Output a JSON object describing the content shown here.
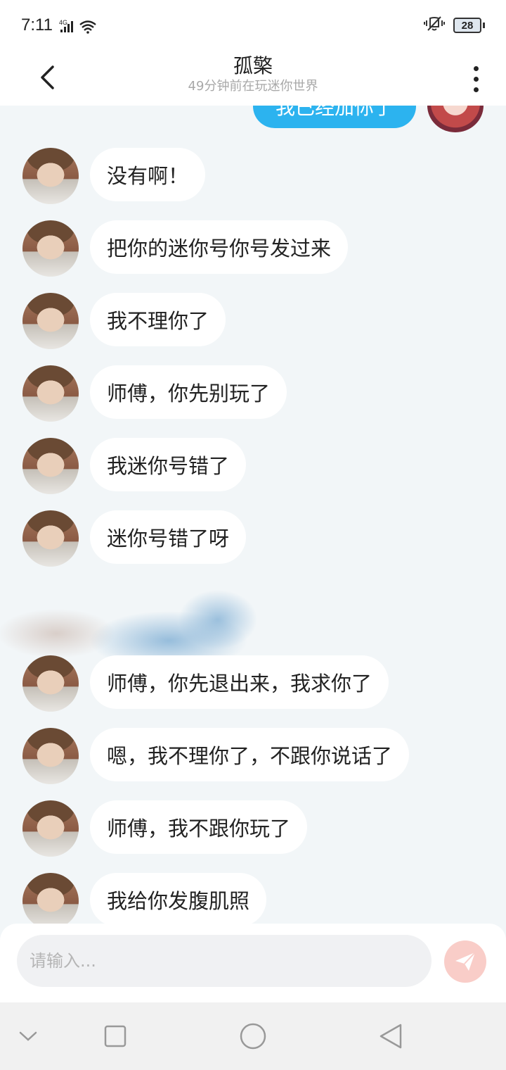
{
  "status_bar": {
    "time": "7:11",
    "network": "4G",
    "battery": "28"
  },
  "header": {
    "title": "孤檠",
    "subtitle": "49分钟前在玩迷你世界"
  },
  "chat": {
    "own_partial_message": "我已经加你了",
    "messages": [
      {
        "text": "没有啊！"
      },
      {
        "text": "把你的迷你号你号发过来"
      },
      {
        "text": "我不理你了"
      },
      {
        "text": "师傅，你先别玩了"
      },
      {
        "text": "我迷你号错了"
      },
      {
        "text": "迷你号错了呀"
      },
      {
        "text": "师傅，你先退出来，我求你了"
      },
      {
        "text": "嗯，我不理你了，不跟你说话了"
      },
      {
        "text": "师傅，我不跟你玩了"
      },
      {
        "text": "我给你发腹肌照"
      }
    ]
  },
  "input": {
    "placeholder": "请输入..."
  },
  "colors": {
    "accent": "#2cb3ef",
    "send_button": "#f9cdc8",
    "background": "#f2f6f8"
  }
}
